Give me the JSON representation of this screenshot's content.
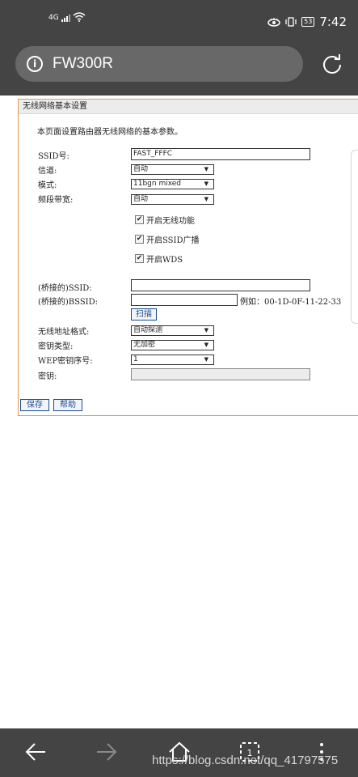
{
  "status_bar": {
    "network": "4G",
    "battery": "53",
    "time": "7:42"
  },
  "browser": {
    "url": "FW300R"
  },
  "panel": {
    "title": "无线网络基本设置",
    "description": "本页面设置路由器无线网络的基本参数。",
    "ssid": {
      "label": "SSID号:",
      "value": "FAST_FFFC"
    },
    "channel": {
      "label": "信道:",
      "value": "自动"
    },
    "mode": {
      "label": "模式:",
      "value": "11bgn mixed"
    },
    "bandwidth": {
      "label": "频段带宽:",
      "value": "自动"
    },
    "checkboxes": [
      {
        "label": "开启无线功能",
        "checked": true
      },
      {
        "label": "开启SSID广播",
        "checked": true
      },
      {
        "label": "开启WDS",
        "checked": true
      }
    ],
    "bridge_ssid": {
      "label": "(桥接的)SSID:",
      "value": ""
    },
    "bridge_bssid": {
      "label": "(桥接的)BSSID:",
      "value": "",
      "example": "例如：00-1D-0F-11-22-33"
    },
    "scan_button": "扫描",
    "addr_format": {
      "label": "无线地址格式:",
      "value": "自动探测"
    },
    "key_type": {
      "label": "密钥类型:",
      "value": "无加密"
    },
    "wep_index": {
      "label": "WEP密钥序号:",
      "value": "1"
    },
    "key": {
      "label": "密钥:",
      "value": ""
    },
    "save_button": "保存",
    "help_button": "帮助"
  },
  "watermark": "https://blog.csdn.net/qq_41797575"
}
